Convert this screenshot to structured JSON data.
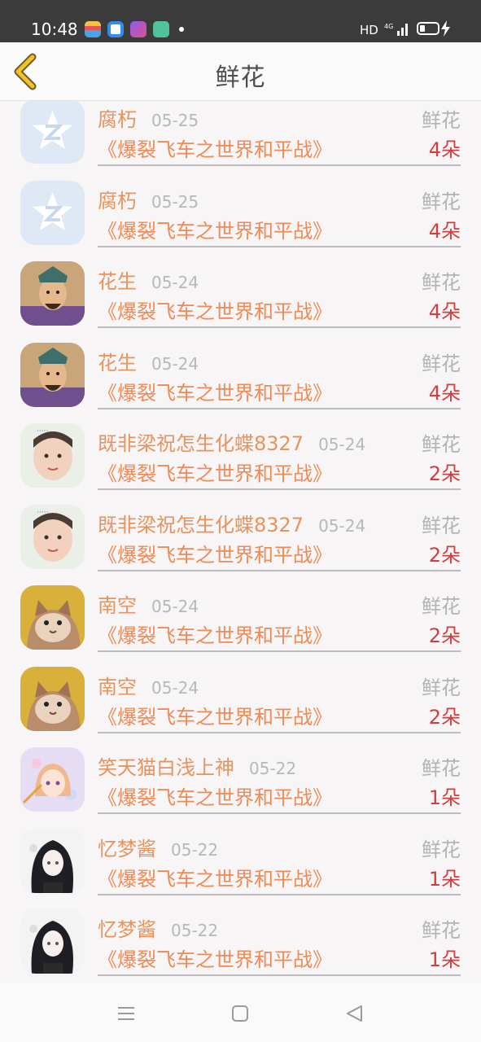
{
  "status_bar": {
    "time": "10:48",
    "network": "HD",
    "signal_label": "4G",
    "icons": [
      "wallet-app-icon",
      "browser-app-icon",
      "shortcut-app-icon",
      "chat-app-icon"
    ]
  },
  "header": {
    "title": "鲜花",
    "back_icon": "chevron-left-icon"
  },
  "colors": {
    "name": "#e8935d",
    "book": "#ef8a56",
    "count": "#d23e3e",
    "muted": "#b3b3b3"
  },
  "rows": [
    {
      "name": "腐朽",
      "date": "05-25",
      "kind": "鲜花",
      "book": "《爆裂飞车之世界和平战》",
      "count": "4朵",
      "avatar": "default-star-avatar"
    },
    {
      "name": "腐朽",
      "date": "05-25",
      "kind": "鲜花",
      "book": "《爆裂飞车之世界和平战》",
      "count": "4朵",
      "avatar": "default-star-avatar"
    },
    {
      "name": "花生",
      "date": "05-24",
      "kind": "鲜花",
      "book": "《爆裂飞车之世界和平战》",
      "count": "4朵",
      "avatar": "warrior-avatar"
    },
    {
      "name": "花生",
      "date": "05-24",
      "kind": "鲜花",
      "book": "《爆裂飞车之世界和平战》",
      "count": "4朵",
      "avatar": "warrior-avatar"
    },
    {
      "name": "既非梁祝怎生化蝶8327",
      "date": "05-24",
      "kind": "鲜花",
      "book": "《爆裂飞车之世界和平战》",
      "count": "2朵",
      "avatar": "girl-photo-avatar"
    },
    {
      "name": "既非梁祝怎生化蝶8327",
      "date": "05-24",
      "kind": "鲜花",
      "book": "《爆裂飞车之世界和平战》",
      "count": "2朵",
      "avatar": "girl-photo-avatar"
    },
    {
      "name": "南空",
      "date": "05-24",
      "kind": "鲜花",
      "book": "《爆裂飞车之世界和平战》",
      "count": "2朵",
      "avatar": "cat-avatar"
    },
    {
      "name": "南空",
      "date": "05-24",
      "kind": "鲜花",
      "book": "《爆裂飞车之世界和平战》",
      "count": "2朵",
      "avatar": "cat-avatar"
    },
    {
      "name": "笑天猫白浅上神",
      "date": "05-22",
      "kind": "鲜花",
      "book": "《爆裂飞车之世界和平战》",
      "count": "1朵",
      "avatar": "anime-girl-avatar"
    },
    {
      "name": "忆梦酱",
      "date": "05-22",
      "kind": "鲜花",
      "book": "《爆裂飞车之世界和平战》",
      "count": "1朵",
      "avatar": "dark-anime-avatar"
    },
    {
      "name": "忆梦酱",
      "date": "05-22",
      "kind": "鲜花",
      "book": "《爆裂飞车之世界和平战》",
      "count": "1朵",
      "avatar": "dark-anime-avatar"
    }
  ],
  "nav_bar": {
    "icons": [
      "menu-icon",
      "home-icon",
      "back-triangle-icon"
    ]
  }
}
